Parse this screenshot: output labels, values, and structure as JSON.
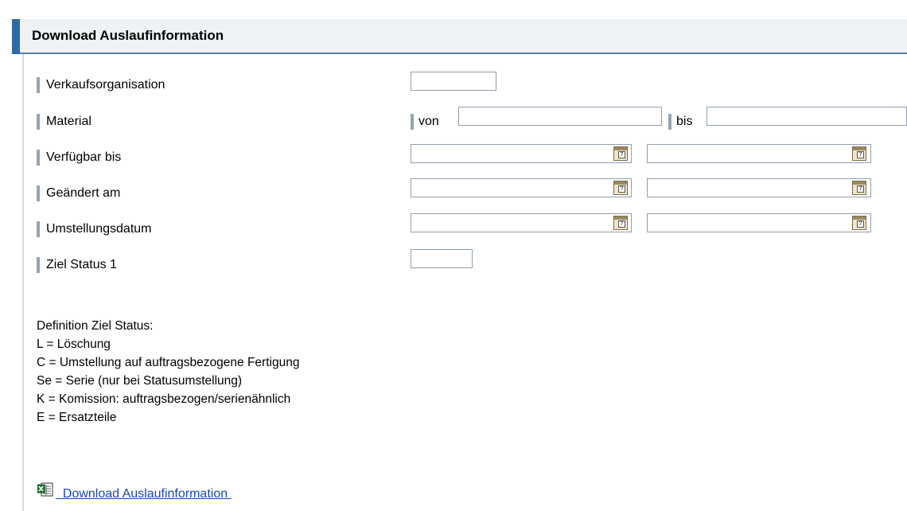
{
  "header": {
    "title": "Download Auslaufinformation"
  },
  "form": {
    "verkaufsorganisation": {
      "label": "Verkaufsorganisation",
      "value": ""
    },
    "material": {
      "label": "Material",
      "from_label": "von",
      "to_label": "bis",
      "from_value": "",
      "to_value": ""
    },
    "verfuegbar_bis": {
      "label": "Verfügbar bis",
      "from_value": "",
      "to_value": ""
    },
    "geaendert_am": {
      "label": "Geändert am",
      "from_value": "",
      "to_value": ""
    },
    "umstellungsdatum": {
      "label": "Umstellungsdatum",
      "from_value": "",
      "to_value": ""
    },
    "ziel_status": {
      "label": "Ziel Status 1",
      "value": ""
    }
  },
  "definition": {
    "title": "Definition Ziel Status:",
    "lines": [
      "L = Löschung",
      "C = Umstellung auf auftragsbezogene Fertigung",
      "Se = Serie (nur bei Statusumstellung)",
      "K = Komission: auftragsbezogen/serienähnlich",
      "E = Ersatzteile"
    ]
  },
  "download": {
    "label": "  Download Auslaufinformation ",
    "icon": "excel-export-icon"
  },
  "colors": {
    "header_accent": "#2e6aa6",
    "header_border": "#5b7ea6",
    "link": "#1747b5",
    "label_marker": "#96a4b3"
  }
}
